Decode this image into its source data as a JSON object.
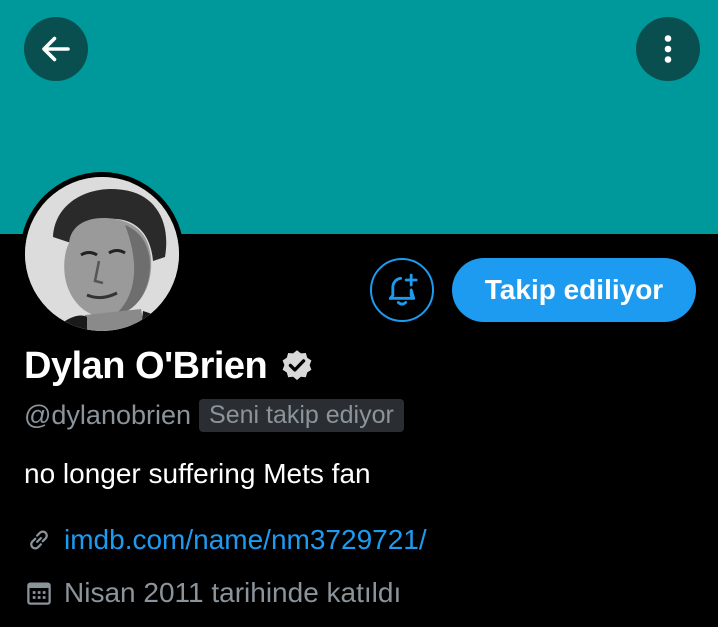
{
  "colors": {
    "banner": "#00999b",
    "accent": "#1d9bf0",
    "background": "#000000",
    "secondary_text": "#8b949b"
  },
  "header": {
    "back_icon": "arrow-left-icon",
    "more_icon": "more-vertical-icon"
  },
  "profile": {
    "name": "Dylan O'Brien",
    "verified": true,
    "handle": "@dylanobrien",
    "follows_you_badge": "Seni takip ediyor",
    "bio": "no longer suffering Mets fan",
    "website": "imdb.com/name/nm3729721/",
    "joined": "Nisan 2011 tarihinde katıldı"
  },
  "actions": {
    "notify_icon": "bell-plus-icon",
    "follow_label": "Takip ediliyor"
  },
  "meta_icons": {
    "link": "link-icon",
    "calendar": "calendar-icon"
  }
}
